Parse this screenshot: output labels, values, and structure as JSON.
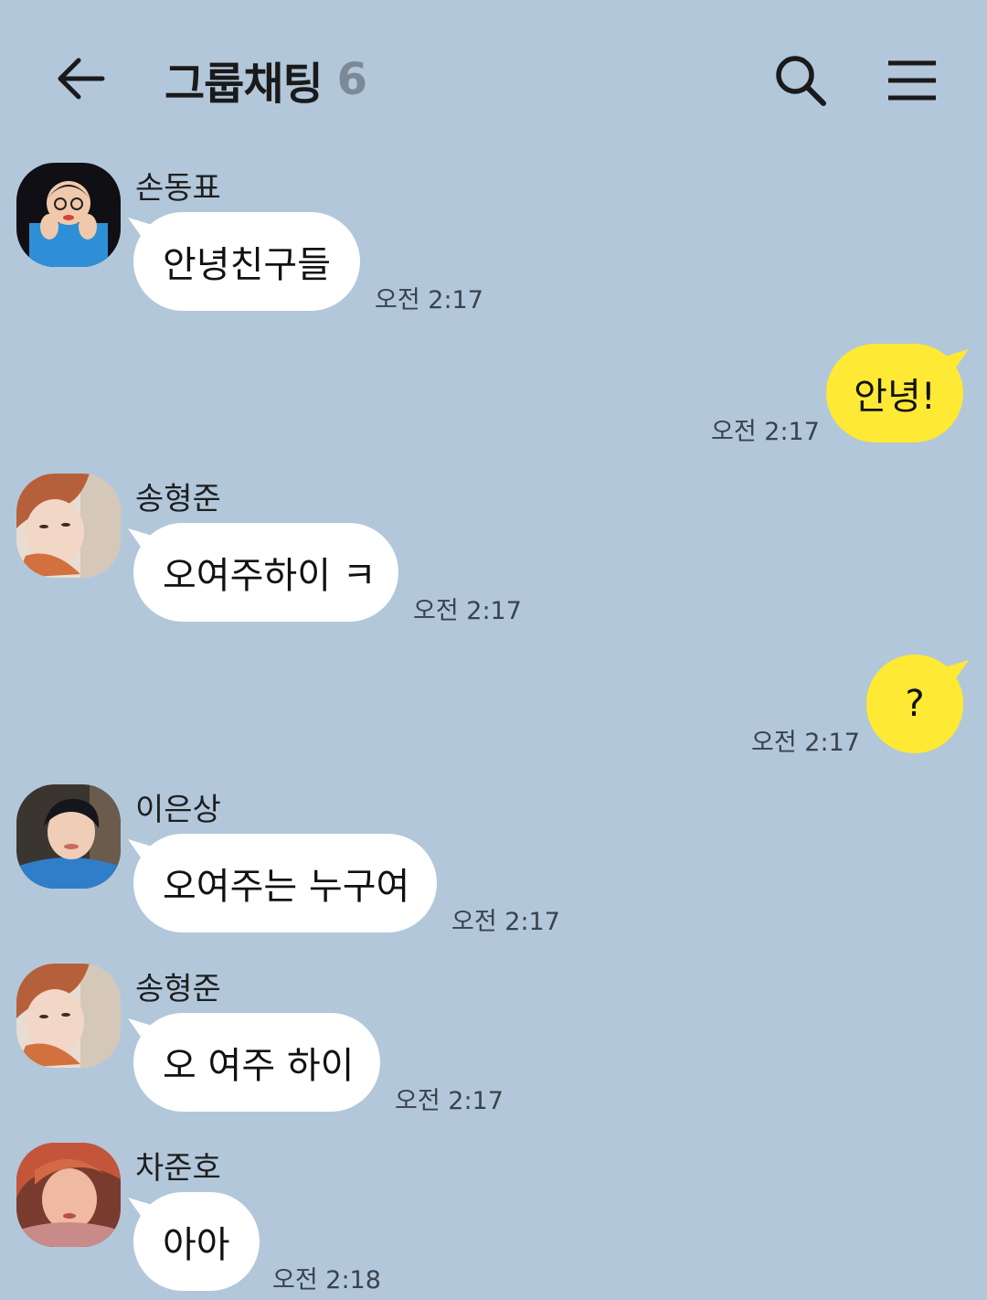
{
  "header": {
    "title": "그룹채팅",
    "member_count": "6",
    "back_icon": "arrow-left-icon",
    "search_icon": "search-icon",
    "menu_icon": "hamburger-menu-icon"
  },
  "colors": {
    "background": "#b2c7da",
    "my_bubble": "#fee934",
    "other_bubble": "#ffffff"
  },
  "messages": [
    {
      "sender": "손동표",
      "text": "안녕친구들",
      "time": "오전 2:17",
      "mine": false
    },
    {
      "sender": "",
      "text": "안녕!",
      "time": "오전 2:17",
      "mine": true
    },
    {
      "sender": "송형준",
      "text": "오여주하이 ㅋ",
      "time": "오전 2:17",
      "mine": false
    },
    {
      "sender": "",
      "text": "?",
      "time": "오전 2:17",
      "mine": true
    },
    {
      "sender": "이은상",
      "text": "오여주는 누구여",
      "time": "오전 2:17",
      "mine": false
    },
    {
      "sender": "송형준",
      "text": "오 여주 하이",
      "time": "오전 2:17",
      "mine": false
    },
    {
      "sender": "차준호",
      "text": "아아",
      "time": "오전 2:18",
      "mine": false
    }
  ]
}
